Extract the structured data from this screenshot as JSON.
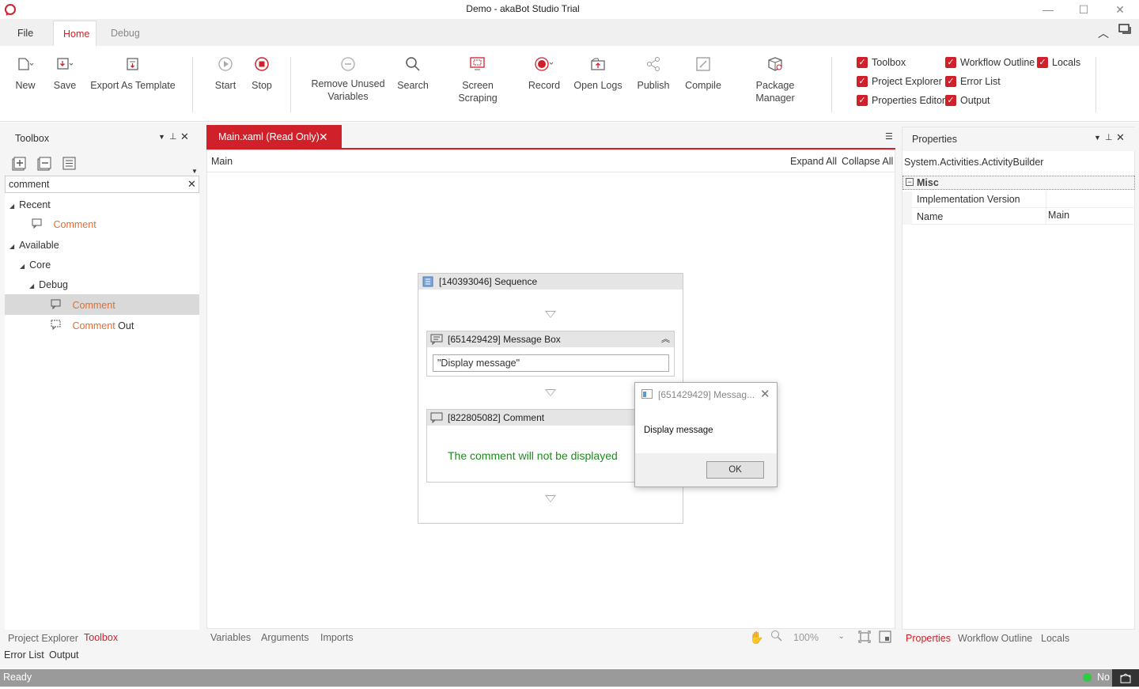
{
  "window": {
    "title": "Demo - akaBot Studio Trial"
  },
  "ribbon_tabs": [
    {
      "label": "File"
    },
    {
      "label": "Home"
    },
    {
      "label": "Debug"
    }
  ],
  "ribbon": {
    "new": "New",
    "save": "Save",
    "export_template": "Export As Template",
    "start": "Start",
    "stop": "Stop",
    "remove_unused_1": "Remove Unused",
    "remove_unused_2": "Variables",
    "search": "Search",
    "screen_scraping": "Screen Scraping",
    "record": "Record",
    "open_logs": "Open Logs",
    "publish": "Publish",
    "compile": "Compile",
    "package_manager": "Package Manager",
    "panels": {
      "toolbox": "Toolbox",
      "project_explorer": "Project Explorer",
      "properties_editor": "Properties Editor",
      "workflow_outline": "Workflow Outline",
      "error_list": "Error List",
      "output": "Output",
      "locals": "Locals"
    }
  },
  "toolbox": {
    "title": "Toolbox",
    "search_value": "comment",
    "recent": "Recent",
    "recent_comment": "Comment",
    "available": "Available",
    "core": "Core",
    "debug": "Debug",
    "debug_comment": "Comment",
    "comment_out_1": "Comment",
    "comment_out_2": " Out"
  },
  "left_bottom_tabs": {
    "project_explorer": "Project Explorer",
    "toolbox": "Toolbox",
    "error_list": "Error List",
    "output": "Output"
  },
  "designer": {
    "tab_title": "Main.xaml (Read Only)",
    "breadcrumb": "Main",
    "expand_all": "Expand All",
    "collapse_all": "Collapse All",
    "sequence_title": "[140393046] Sequence",
    "msgbox_title": "[651429429] Message Box",
    "msgbox_value": "\"Display message\"",
    "comment_title": "[822805082] Comment",
    "comment_text": "The comment will not be displayed",
    "bottom_tabs": {
      "variables": "Variables",
      "arguments": "Arguments",
      "imports": "Imports"
    },
    "zoom": "100%"
  },
  "dialog": {
    "title": "[651429429] Messag...",
    "message": "Display message",
    "ok": "OK"
  },
  "properties": {
    "title": "Properties",
    "type": "System.Activities.ActivityBuilder",
    "category": "Misc",
    "rows": [
      {
        "name": "Implementation Version",
        "value": ""
      },
      {
        "name": "Name",
        "value": "Main"
      }
    ],
    "bottom_tabs": {
      "properties": "Properties",
      "workflow_outline": "Workflow Outline",
      "locals": "Locals"
    }
  },
  "status": {
    "text": "Ready",
    "right": "No"
  },
  "colors": {
    "accent": "#d0212b",
    "orange": "#e26d32",
    "comment_green": "#1f8a1f"
  }
}
